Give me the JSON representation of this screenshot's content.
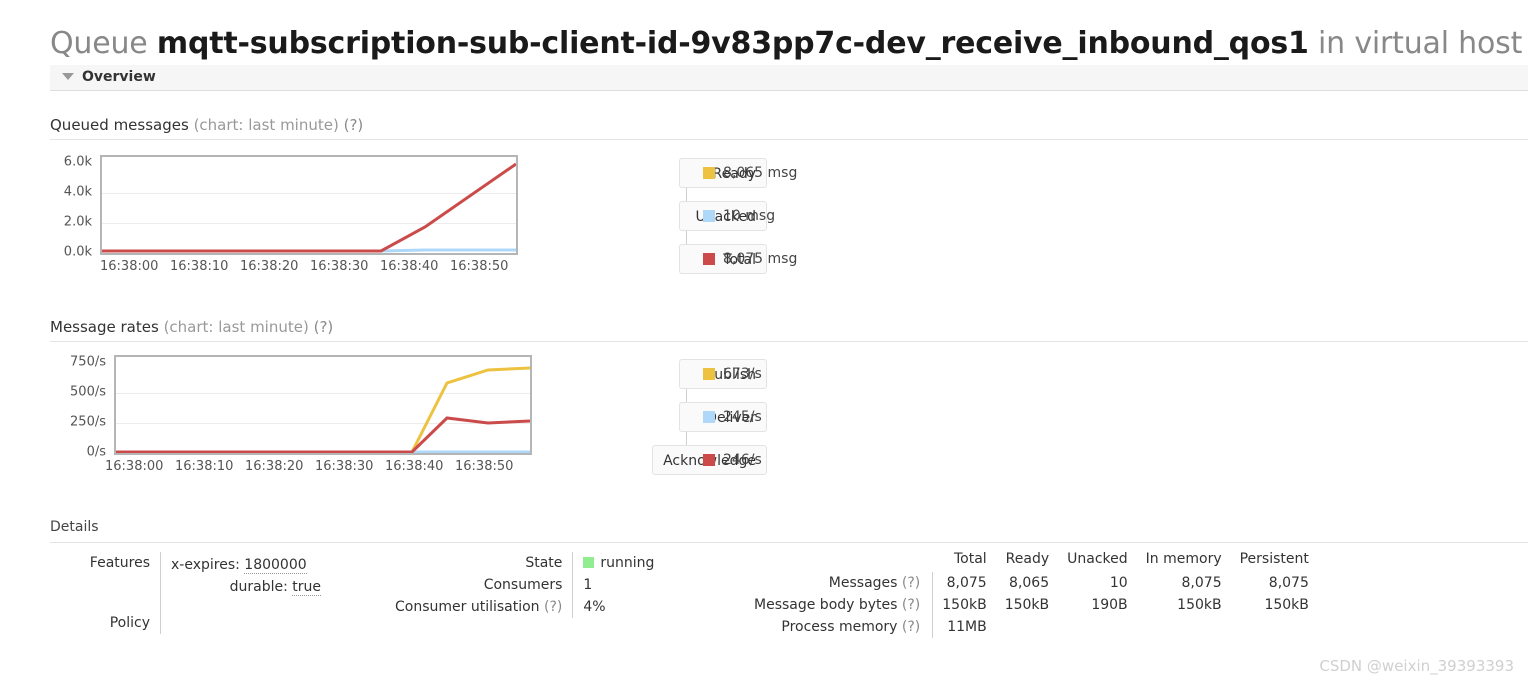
{
  "page": {
    "title_prefix": "Queue",
    "queue_name": "mqtt-subscription-sub-client-id-9v83pp7c-dev_receive_inbound_qos1",
    "title_suffix": "in virtual host /",
    "watermark": "CSDN @weixin_39393393"
  },
  "overview_section": {
    "label": "Overview",
    "expanded": true,
    "twisty_icon": "triangle-down-icon"
  },
  "queued_messages": {
    "heading": "Queued messages",
    "heading_note": "(chart: last minute)",
    "help": "(?)",
    "legend": [
      {
        "key": "Ready",
        "value": "8,065 msg",
        "color": "#edc240"
      },
      {
        "key": "Unacked",
        "value": "10 msg",
        "color": "#afd8f8"
      },
      {
        "key": "Total",
        "value": "8,075 msg",
        "color": "#cb4b4b"
      }
    ]
  },
  "message_rates": {
    "heading": "Message rates",
    "heading_note": "(chart: last minute)",
    "help": "(?)",
    "legend": [
      {
        "key": "Publish",
        "value": "673/s",
        "color": "#edc240"
      },
      {
        "key": "Deliver",
        "value": "245/s",
        "color": "#afd8f8"
      },
      {
        "key": "Acknowledge",
        "value": "246/s",
        "color": "#cb4b4b"
      }
    ]
  },
  "chart_data": [
    {
      "type": "line",
      "name": "queued-messages",
      "title": "Queued messages (chart: last minute)",
      "xlabel": "",
      "ylabel": "",
      "x": [
        "16:38:00",
        "16:38:10",
        "16:38:20",
        "16:38:30",
        "16:38:40",
        "16:38:50"
      ],
      "xticklabels": [
        "16:38:00",
        "16:38:10",
        "16:38:20",
        "16:38:30",
        "16:38:40",
        "16:38:50"
      ],
      "yticklabels": [
        "0.0k",
        "2.0k",
        "4.0k",
        "6.0k"
      ],
      "ylim": [
        0,
        6000
      ],
      "ytick_values": [
        0,
        2000,
        4000,
        6000
      ],
      "grid": true,
      "legend_position": "right",
      "series": [
        {
          "name": "Total",
          "color": "#cb4b4b",
          "x_fraction": [
            0.0,
            0.1,
            0.2,
            0.3,
            0.4,
            0.5,
            0.6,
            0.675,
            0.78,
            1.0
          ],
          "values": [
            5,
            5,
            5,
            5,
            5,
            5,
            5,
            10,
            1500,
            5600
          ]
        },
        {
          "name": "Unacked",
          "color": "#afd8f8",
          "x_fraction": [
            0.0,
            0.675,
            0.78,
            1.0
          ],
          "values": [
            0,
            0,
            10,
            10
          ]
        },
        {
          "name": "Ready",
          "color": "#edc240",
          "x_fraction": [
            0.0,
            0.675,
            1.0
          ],
          "values": [
            0,
            0,
            0
          ]
        }
      ]
    },
    {
      "type": "line",
      "name": "message-rates",
      "title": "Message rates (chart: last minute)",
      "xlabel": "",
      "ylabel": "",
      "x": [
        "16:38:00",
        "16:38:10",
        "16:38:20",
        "16:38:30",
        "16:38:40",
        "16:38:50"
      ],
      "xticklabels": [
        "16:38:00",
        "16:38:10",
        "16:38:20",
        "16:38:30",
        "16:38:40",
        "16:38:50"
      ],
      "yticklabels": [
        "0/s",
        "250/s",
        "500/s",
        "750/s"
      ],
      "ylim": [
        0,
        750
      ],
      "ytick_values": [
        0,
        250,
        500,
        750
      ],
      "grid": true,
      "legend_position": "right",
      "series": [
        {
          "name": "Publish",
          "color": "#edc240",
          "x_fraction": [
            0.0,
            0.2,
            0.4,
            0.6,
            0.715,
            0.8,
            0.88,
            1.0
          ],
          "values": [
            0,
            0,
            0,
            0,
            0,
            540,
            650,
            673
          ]
        },
        {
          "name": "Acknowledge",
          "color": "#cb4b4b",
          "x_fraction": [
            0.0,
            0.2,
            0.4,
            0.6,
            0.715,
            0.8,
            0.9,
            1.0
          ],
          "values": [
            3,
            3,
            3,
            3,
            3,
            270,
            240,
            246
          ]
        },
        {
          "name": "Deliver",
          "color": "#afd8f8",
          "x_fraction": [
            0.0,
            0.715,
            1.0
          ],
          "values": [
            0,
            0,
            0
          ]
        }
      ]
    }
  ],
  "details": {
    "heading": "Details",
    "features": {
      "label": "Features",
      "items": [
        {
          "name": "x-expires:",
          "value": "1800000"
        },
        {
          "name": "durable:",
          "value": "true"
        }
      ]
    },
    "policy": {
      "label": "Policy",
      "value": ""
    },
    "state": {
      "label": "State",
      "value": "running",
      "color": "#90ee90"
    },
    "consumers": {
      "label": "Consumers",
      "value": "1"
    },
    "consumer_utilisation": {
      "label": "Consumer utilisation",
      "help": "(?)",
      "value": "4%"
    },
    "stats": {
      "columns": [
        "",
        "Total",
        "Ready",
        "Unacked",
        "In memory",
        "Persistent"
      ],
      "rows": [
        {
          "label": "Messages",
          "help": "(?)",
          "cells": [
            "8,075",
            "8,065",
            "10",
            "8,075",
            "8,075"
          ]
        },
        {
          "label": "Message body bytes",
          "help": "(?)",
          "cells": [
            "150kB",
            "150kB",
            "190B",
            "150kB",
            "150kB"
          ]
        },
        {
          "label": "Process memory",
          "help": "(?)",
          "cells": [
            "11MB",
            "",
            "",
            "",
            ""
          ]
        }
      ]
    }
  }
}
